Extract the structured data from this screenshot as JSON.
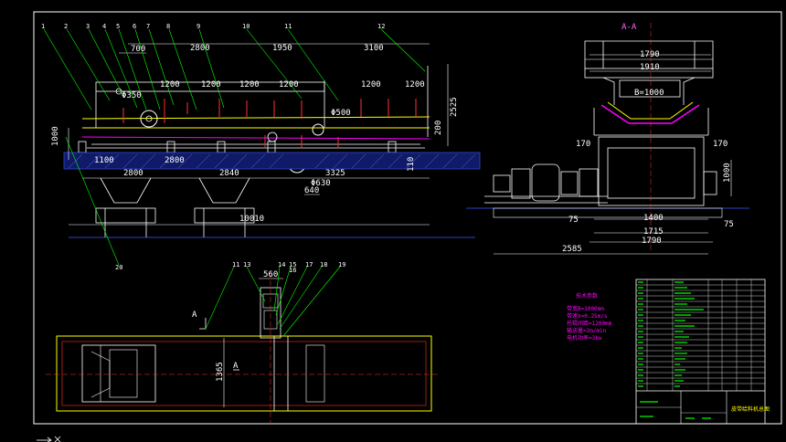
{
  "side_view": {
    "callouts_top": [
      "1",
      "2",
      "3",
      "4",
      "5",
      "6",
      "7",
      "8",
      "9",
      "10",
      "11",
      "12"
    ],
    "callout_left_bottom": "20",
    "dims": {
      "d700": "700",
      "d2800a": "2800",
      "d1950": "1950",
      "d3100": "3100",
      "d1200a": "1200",
      "d1200b": "1200",
      "d1200c": "1200",
      "d1200d": "1200",
      "d1200e": "1200",
      "d1200f": "1200",
      "d2525": "2525",
      "d1000": "1000",
      "d350": "Φ350",
      "d500": "Φ500",
      "d200": "200",
      "d1100": "1100",
      "d2800b": "2800",
      "d2800c": "2800",
      "d2840": "2840",
      "d3325": "3325",
      "d630": "Φ630",
      "d640": "640",
      "d10010": "10010",
      "d110": "110"
    }
  },
  "end_view": {
    "section_mark": "A-A",
    "dims": {
      "d1790t": "1790",
      "d1910": "1910",
      "d_b": "B=1000",
      "d170l": "170",
      "d170r": "170",
      "d1000v": "1000",
      "d75l": "75",
      "d75r": "75",
      "d1400": "1400",
      "d1715": "1715",
      "d1790b": "1790",
      "d2585": "2585"
    }
  },
  "plan_view": {
    "callouts": [
      "11",
      "13",
      "14",
      "15",
      "16",
      "17",
      "18",
      "19"
    ],
    "dims": {
      "d560": "560",
      "d1365": "1365"
    },
    "mark_a": "A",
    "mark_a2": "A"
  },
  "tech_notes": {
    "title": "技术参数",
    "lines": [
      "带宽B=1000mm",
      "带速V=0.25m/s",
      "托辊间距=1200mm",
      "输送量=2m/min",
      "电机功率=3kw"
    ]
  },
  "title_block": {
    "title": "皮带给料机总图"
  }
}
